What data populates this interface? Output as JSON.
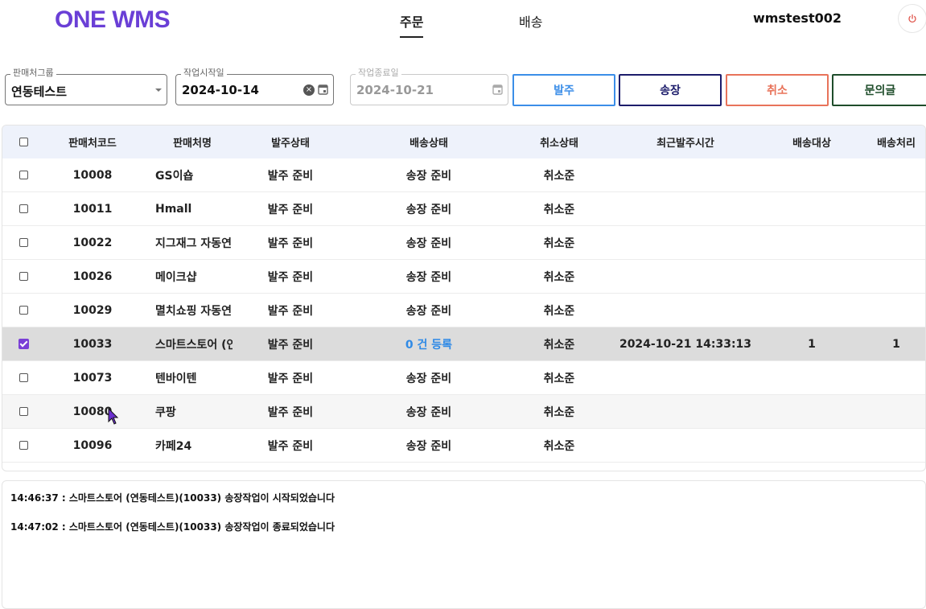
{
  "header": {
    "logo": "ONE WMS",
    "nav": [
      {
        "label": "주문",
        "active": true
      },
      {
        "label": "배송",
        "active": false
      }
    ],
    "user": "wmstest002"
  },
  "filters": {
    "group": {
      "label": "판매처그룹",
      "value": "연동테스트"
    },
    "start_date": {
      "label": "작업시작일",
      "value": "2024-10-14"
    },
    "end_date": {
      "label": "작업종료일",
      "value": "2024-10-21"
    }
  },
  "actions": [
    {
      "label": "발주",
      "color": "#3b8ee8"
    },
    {
      "label": "송장",
      "color": "#1c1c6b"
    },
    {
      "label": "취소",
      "color": "#e8735a"
    },
    {
      "label": "문의글",
      "color": "#1f4d2b"
    }
  ],
  "table": {
    "headers": [
      "판매처코드",
      "판매처명",
      "발주상태",
      "배송상태",
      "취소상태",
      "최근발주시간",
      "배송대상",
      "배송처리"
    ],
    "rows": [
      {
        "code": "10008",
        "name": "GS이숍",
        "order": "발주 준비",
        "ship": "송장 준비",
        "cancel": "취소준",
        "time": "",
        "target": "",
        "done": ""
      },
      {
        "code": "10011",
        "name": "Hmall",
        "order": "발주 준비",
        "ship": "송장 준비",
        "cancel": "취소준",
        "time": "",
        "target": "",
        "done": ""
      },
      {
        "code": "10022",
        "name": "지그재그 자동연",
        "order": "발주 준비",
        "ship": "송장 준비",
        "cancel": "취소준",
        "time": "",
        "target": "",
        "done": ""
      },
      {
        "code": "10026",
        "name": "메이크샵",
        "order": "발주 준비",
        "ship": "송장 준비",
        "cancel": "취소준",
        "time": "",
        "target": "",
        "done": ""
      },
      {
        "code": "10029",
        "name": "멸치쇼핑 자동연",
        "order": "발주 준비",
        "ship": "송장 준비",
        "cancel": "취소준",
        "time": "",
        "target": "",
        "done": ""
      },
      {
        "code": "10033",
        "name": "스마트스토어 (연",
        "order": "발주 준비",
        "ship": "0 건 등록",
        "cancel": "취소준",
        "time": "2024-10-21 14:33:13",
        "target": "1",
        "done": "1"
      },
      {
        "code": "10073",
        "name": "텐바이텐",
        "order": "발주 준비",
        "ship": "송장 준비",
        "cancel": "취소준",
        "time": "",
        "target": "",
        "done": ""
      },
      {
        "code": "10080",
        "name": "쿠팡",
        "order": "발주 준비",
        "ship": "송장 준비",
        "cancel": "취소준",
        "time": "",
        "target": "",
        "done": ""
      },
      {
        "code": "10096",
        "name": "카페24",
        "order": "발주 준비",
        "ship": "송장 준비",
        "cancel": "취소준",
        "time": "",
        "target": "",
        "done": ""
      }
    ]
  },
  "log": [
    "14:46:37 : 스마트스토어 (연동테스트)(10033) 송장작업이 시작되었습니다",
    "14:47:02 : 스마트스토어 (연동테스트)(10033) 송장작업이 종료되었습니다"
  ]
}
